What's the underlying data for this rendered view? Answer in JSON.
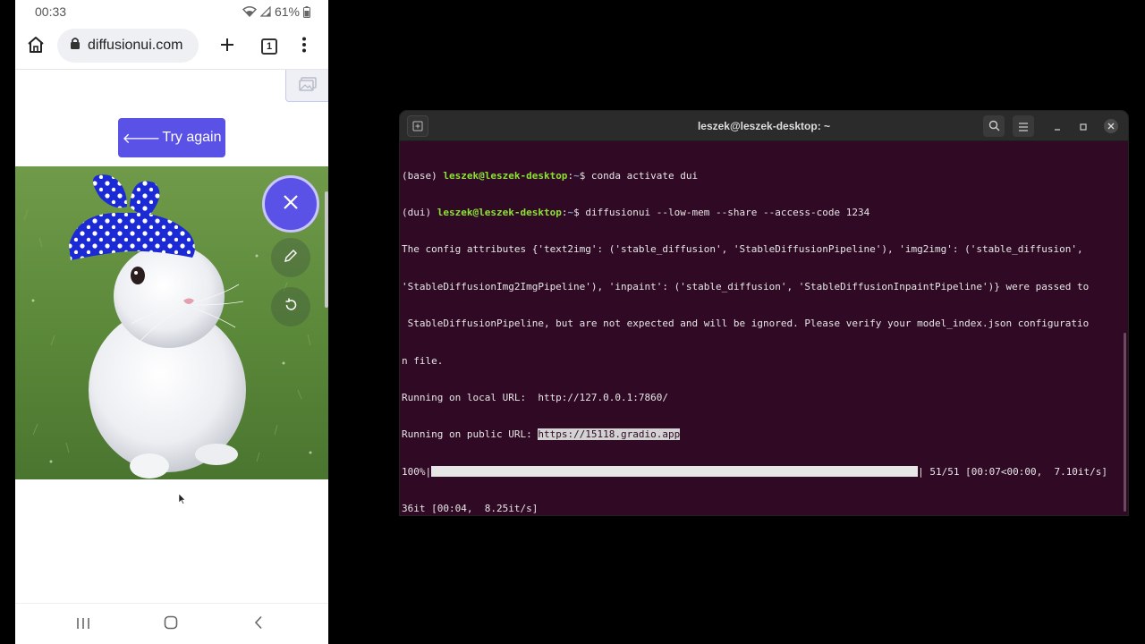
{
  "phone": {
    "status": {
      "time": "00:33",
      "battery": "61%"
    },
    "browser": {
      "url": "diffusionui.com",
      "tab_count": "1"
    },
    "content": {
      "try_again_arrow": "🡐",
      "try_again_label": "Try again"
    }
  },
  "terminal": {
    "title": "leszek@leszek-desktop: ~",
    "lines": {
      "l1_env": "(base) ",
      "l1_user": "leszek@leszek-desktop",
      "l1_colon": ":",
      "l1_path": "~",
      "l1_cmd": "$ conda activate dui",
      "l2_env": "(dui) ",
      "l2_user": "leszek@leszek-desktop",
      "l2_colon": ":",
      "l2_path": "~",
      "l2_cmd": "$ diffusionui --low-mem --share --access-code 1234",
      "l3": "The config attributes {'text2img': ('stable_diffusion', 'StableDiffusionPipeline'), 'img2img': ('stable_diffusion',",
      "l4": "'StableDiffusionImg2ImgPipeline'), 'inpaint': ('stable_diffusion', 'StableDiffusionInpaintPipeline')} were passed to",
      "l5": " StableDiffusionPipeline, but are not expected and will be ignored. Please verify your model_index.json configuratio",
      "l6": "n file.",
      "l7": "Running on local URL:  http://127.0.0.1:7860/",
      "l8_label": "Running on public URL: ",
      "l8_url": "https://15118.gradio.app",
      "l9_pct": "100%|",
      "l9_stats": "| 51/51 [00:07<00:00,  7.10it/s]",
      "l10": "36it [00:04,  8.25it/s]"
    },
    "progress": 1.0
  }
}
